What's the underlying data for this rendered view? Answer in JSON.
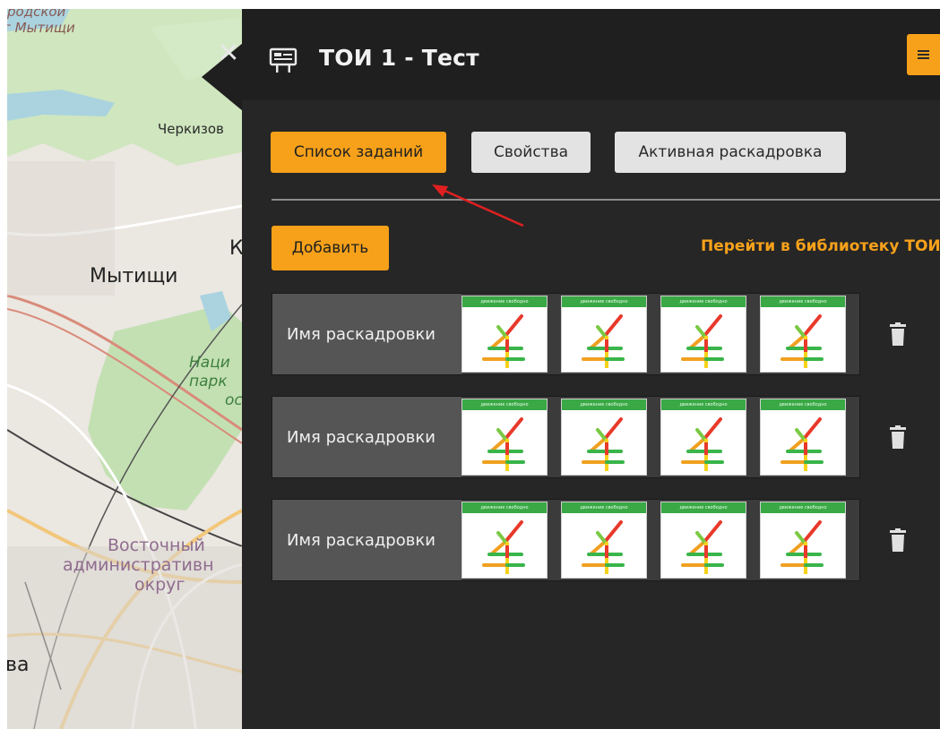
{
  "map": {
    "labels": {
      "city1": "родской",
      "city2": "г Мытищи",
      "cherkizovo": "Черкизов",
      "k_letter": "К",
      "mytishchi": "Мытищи",
      "nats1": "Наци",
      "park": "парк",
      "os": "ос",
      "vost1": "Восточный",
      "vost2": "административн",
      "vost3": "округ",
      "va": "ва"
    }
  },
  "header": {
    "close_glyph": "✕",
    "title": "ТОИ 1 - Тест",
    "board_icon": "billboard-icon",
    "menu_icon": "hamburger-menu-icon"
  },
  "tabs": [
    {
      "label": "Список заданий",
      "active": true
    },
    {
      "label": "Свойства",
      "active": false
    },
    {
      "label": "Активная раскадровка",
      "active": false
    }
  ],
  "actions": {
    "add_label": "Добавить",
    "library_link": "Перейти в библиотеку ТОИ"
  },
  "storyboards": [
    {
      "name": "Имя раскадровки",
      "frames": [
        "движение свободно",
        "движение свободно",
        "движение свободно",
        "движение свободно"
      ]
    },
    {
      "name": "Имя раскадровки",
      "frames": [
        "движение свободно",
        "движение свободно",
        "движение свободно",
        "движение свободно"
      ]
    },
    {
      "name": "Имя раскадровки",
      "frames": [
        "движение свободно",
        "движение свободно",
        "движение свободно",
        "движение свободно"
      ]
    }
  ],
  "colors": {
    "accent": "#f7a11a",
    "panel": "#262626",
    "frame_banner": "#39a845",
    "annotation_arrow": "#e02020"
  }
}
